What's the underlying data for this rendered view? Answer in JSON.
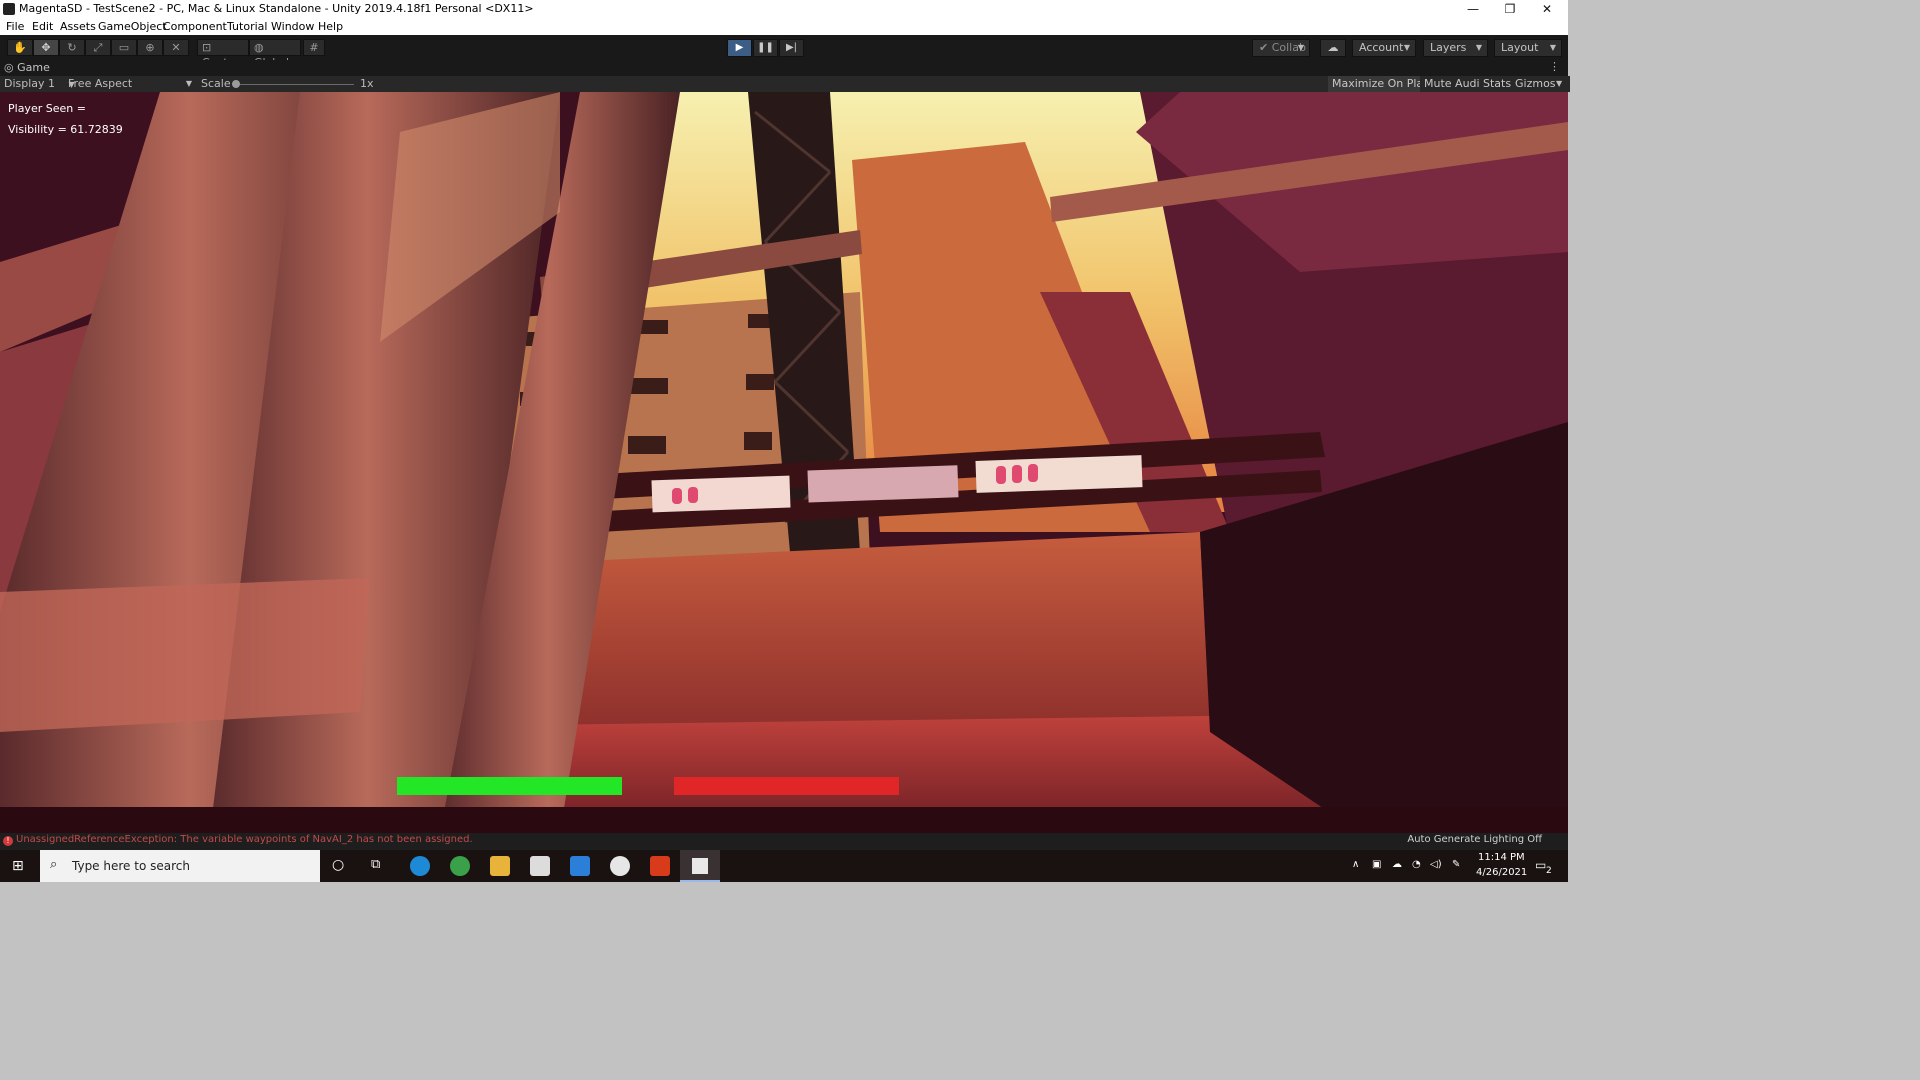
{
  "window": {
    "title": "MagentaSD - TestScene2 - PC, Mac & Linux Standalone - Unity 2019.4.18f1 Personal <DX11>",
    "controls": [
      "—",
      "❐",
      "✕"
    ]
  },
  "menu": [
    "File",
    "Edit",
    "Assets",
    "GameObject",
    "Component",
    "Tutorial",
    "Window",
    "Help"
  ],
  "toolbar": {
    "tools": [
      "hand-icon",
      "move-icon",
      "rotate-icon",
      "scale-icon",
      "rect-icon",
      "transform-icon",
      "custom-tool-icon"
    ],
    "pivot": "Center",
    "space": "Global",
    "snap_icon": "grid-snap-icon",
    "collab": "Collab",
    "account": "Account",
    "layers": "Layers",
    "layout": "Layout"
  },
  "game_tab": {
    "label": "Game",
    "display": "Display 1",
    "aspect": "Free Aspect",
    "scale_label": "Scale",
    "scale_value": "1x",
    "buttons": [
      "Maximize On Play",
      "Mute Audio",
      "Stats",
      "Gizmos"
    ]
  },
  "hud": {
    "player_seen": "Player Seen =",
    "visibility": "Visibility = 61.72839",
    "bar_left_color": "#22e626",
    "bar_right_color": "#e02626"
  },
  "status": {
    "error": "UnassignedReferenceException: The variable waypoints of NavAI_2 has not been assigned.",
    "right": "Auto Generate Lighting Off"
  },
  "taskbar": {
    "search_placeholder": "Type here to search",
    "time": "11:14 PM",
    "date": "4/26/2021",
    "notifications": "2"
  }
}
